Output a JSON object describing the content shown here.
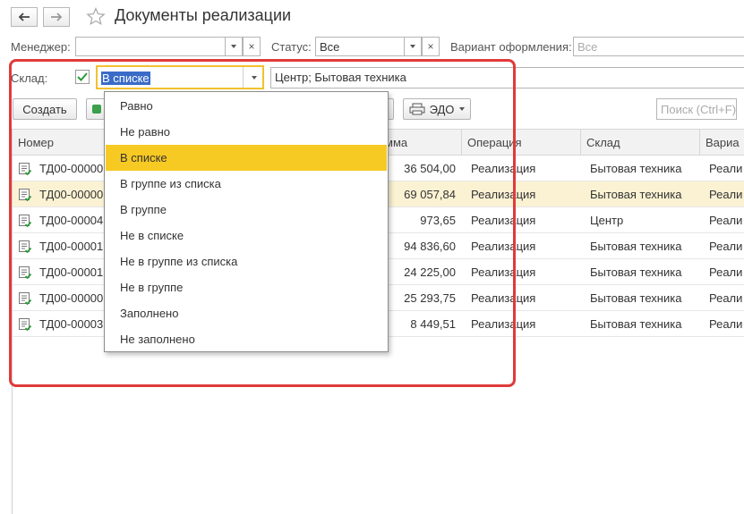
{
  "header": {
    "title": "Документы реализации",
    "back_icon": "arrow-left-icon",
    "forward_icon": "arrow-right-icon",
    "favorite_icon": "star-icon"
  },
  "filters": {
    "manager_label": "Менеджер:",
    "manager_value": "",
    "status_label": "Статус:",
    "status_value": "Все",
    "variant_label": "Вариант оформления:",
    "variant_placeholder": "Все",
    "clear_glyph": "×"
  },
  "warehouse_filter": {
    "label": "Склад:",
    "checked": true,
    "condition_value": "В списке",
    "list_value": "Центр; Бытовая техника"
  },
  "toolbar": {
    "create_label": "Создать",
    "edo_label": "ЭДО",
    "search_placeholder": "Поиск (Ctrl+F)"
  },
  "table": {
    "columns": [
      "Номер",
      "мма",
      "Операция",
      "Склад",
      "Вариа"
    ],
    "rows": [
      {
        "number": "ТД00-00000",
        "sum": "36 504,00",
        "operation": "Реализация",
        "warehouse": "Бытовая техника",
        "variant": "Реали"
      },
      {
        "number": "ТД00-00000",
        "sum": "69 057,84",
        "operation": "Реализация",
        "warehouse": "Бытовая техника",
        "variant": "Реали"
      },
      {
        "number": "ТД00-00004",
        "sum": "973,65",
        "operation": "Реализация",
        "warehouse": "Центр",
        "variant": "Реали"
      },
      {
        "number": "ТД00-00001",
        "sum": "94 836,60",
        "operation": "Реализация",
        "warehouse": "Бытовая техника",
        "variant": "Реали"
      },
      {
        "number": "ТД00-00001",
        "sum": "24 225,00",
        "operation": "Реализация",
        "warehouse": "Бытовая техника",
        "variant": "Реали"
      },
      {
        "number": "ТД00-00000",
        "sum": "25 293,75",
        "operation": "Реализация",
        "warehouse": "Бытовая техника",
        "variant": "Реали"
      },
      {
        "number": "ТД00-00003",
        "sum": "8 449,51",
        "operation": "Реализация",
        "warehouse": "Бытовая техника",
        "variant": "Реали"
      }
    ],
    "highlighted_row": 1
  },
  "dropdown": {
    "items": [
      "Равно",
      "Не равно",
      "В списке",
      "В группе из списка",
      "В группе",
      "Не в списке",
      "Не в группе из списка",
      "Не в группе",
      "Заполнено",
      "Не заполнено"
    ],
    "selected_index": 2
  },
  "colors": {
    "selection": "#f7c923",
    "annotation": "#e03a3a",
    "row_highlight": "#fbf2d3",
    "check": "#2a9a3a",
    "focus_border": "#f2c12e"
  }
}
